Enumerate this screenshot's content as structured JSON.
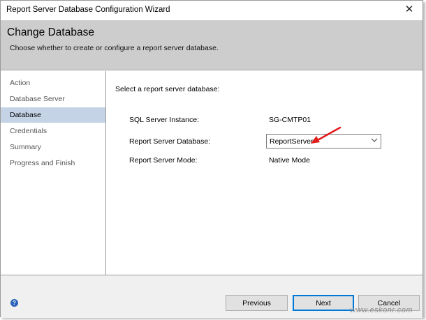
{
  "window": {
    "title": "Report Server Database Configuration Wizard",
    "close_glyph": "✕"
  },
  "header": {
    "title": "Change Database",
    "subtitle": "Choose whether to create or configure a report server database."
  },
  "sidebar": {
    "items": [
      {
        "label": "Action"
      },
      {
        "label": "Database Server"
      },
      {
        "label": "Database",
        "active": true
      },
      {
        "label": "Credentials"
      },
      {
        "label": "Summary"
      },
      {
        "label": "Progress and Finish"
      }
    ]
  },
  "content": {
    "prompt": "Select a report server database:",
    "instance_label": "SQL Server Instance:",
    "instance_value": "SG-CMTP01",
    "database_label": "Report Server Database:",
    "database_value": "ReportServer",
    "mode_label": "Report Server Mode:",
    "mode_value": "Native Mode"
  },
  "footer": {
    "help_glyph": "?",
    "previous_label": "Previous",
    "next_label": "Next",
    "cancel_label": "Cancel",
    "watermark": "www.eskonr.com"
  },
  "colors": {
    "header_bg": "#cdcdcd",
    "sidebar_active": "#c5d3e6",
    "primary_border": "#0078d7",
    "arrow": "#e21b1b"
  },
  "icons": {
    "help": "help-icon",
    "dropdown": "chevron-down-icon",
    "close": "close-icon",
    "annotation": "red-arrow-icon"
  }
}
